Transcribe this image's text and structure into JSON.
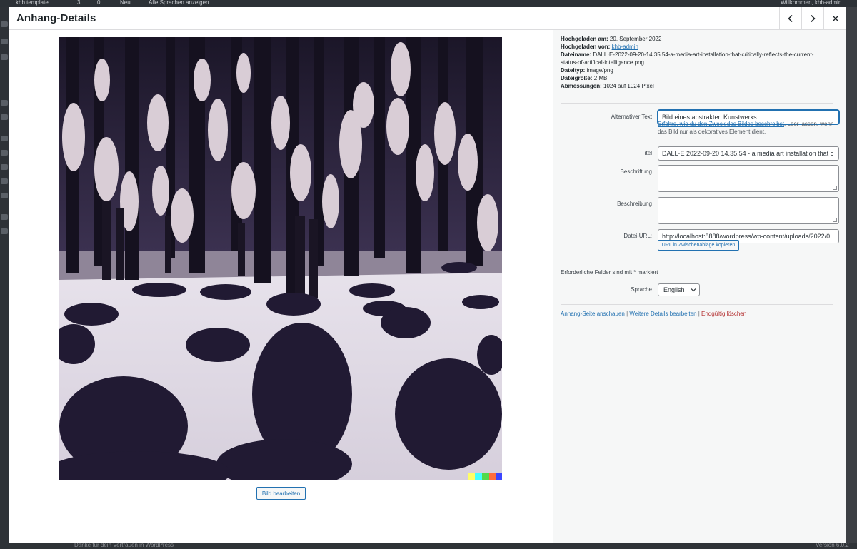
{
  "background": {
    "adminbar": {
      "site": "khb template",
      "updates": "3",
      "comments": "0",
      "new": "Neu",
      "languages": "Alle Sprachen anzeigen",
      "greeting": "Willkommen, khb-admin"
    },
    "footer": {
      "left": "Danke für dein Vertrauen in WordPress",
      "right": "Version 6.0.2"
    }
  },
  "modal": {
    "title": "Anhang-Details",
    "icons": {
      "prev": "chevron-left-icon",
      "next": "chevron-right-icon",
      "close": "close-icon"
    }
  },
  "attachment": {
    "uploaded_on_label": "Hochgeladen am:",
    "uploaded_on": "20. September 2022",
    "uploaded_by_label": "Hochgeladen von:",
    "uploaded_by": "khb-admin",
    "filename_label": "Dateiname:",
    "filename_1": "DALL·E-2022-09-20-14.35.54-a-media-art-installation-that-critically-reflects-the-current-",
    "filename_2": "status-of-artifical-intelligence.png",
    "filetype_label": "Dateityp:",
    "filetype": "image/png",
    "filesize_label": "Dateigröße:",
    "filesize": "2 MB",
    "dimensions_label": "Abmessungen:",
    "dimensions": "1024 auf 1024 Pixel"
  },
  "edit_image_button": "Bild bearbeiten",
  "fields": {
    "alt_label": "Alternativer Text",
    "alt_value": "Bild eines abstrakten Kunstwerks",
    "alt_help_link": "Erfahre, wie du den Zweck des Bildes beschreibst",
    "alt_help_text": ". Leer lassen, wenn das Bild nur als dekoratives Element dient.",
    "title_label": "Titel",
    "title_value": "DALL·E 2022-09-20 14.35.54 - a media art installation that c",
    "caption_label": "Beschriftung",
    "description_label": "Beschreibung",
    "url_label": "Datei-URL:",
    "url_value": "http://localhost:8888/wordpress/wp-content/uploads/2022/0",
    "copy_button": "URL in Zwischenablage kopieren",
    "required_note": "Erforderliche Felder sind mit * markiert",
    "language_label": "Sprache",
    "language_value": "English"
  },
  "actions": {
    "view": "Anhang-Seite anschauen",
    "edit": "Weitere Details bearbeiten",
    "delete": "Endgültig löschen",
    "separator": " | "
  },
  "colors": {
    "accent": "#2271b1",
    "danger": "#b32d2e",
    "sidebar_bg": "#f6f7f7"
  }
}
